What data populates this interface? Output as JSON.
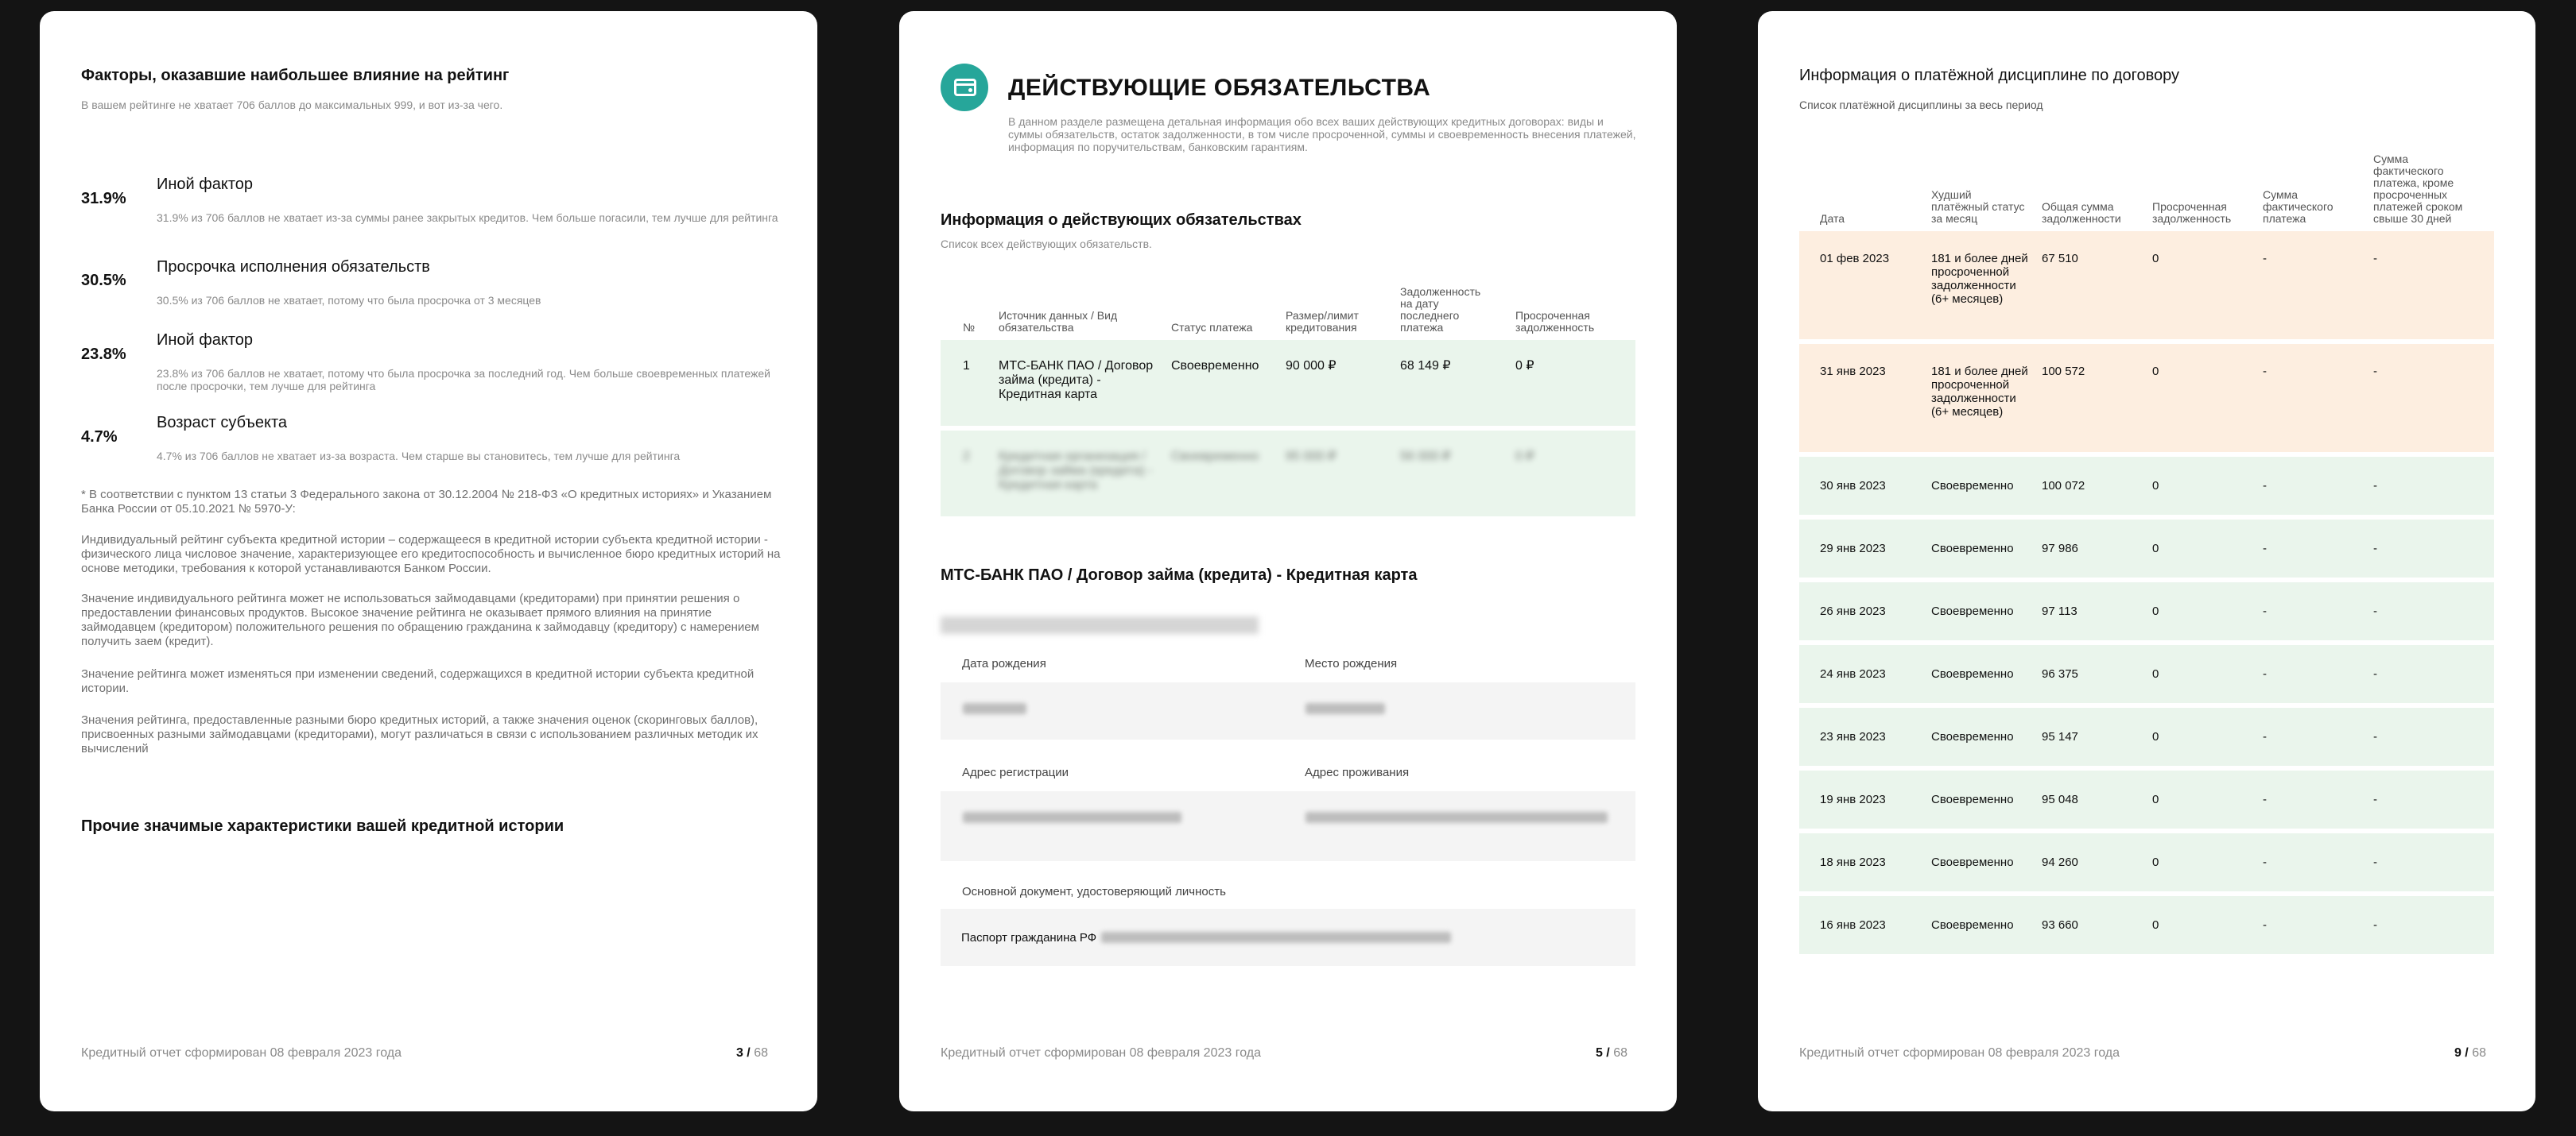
{
  "footer_text": "Кредитный отчет сформирован 08 февраля 2023 года",
  "total_pages": "68",
  "page1": {
    "page_number": "3 /",
    "title": "Факторы, оказавшие наибольшее влияние на рейтинг",
    "subtitle": "В вашем рейтинге не хватает 706  баллов до максимальных 999, и вот из-за чего.",
    "factors": [
      {
        "pct": "31.9%",
        "name": "Иной фактор",
        "desc": "31.9% из 706 баллов не хватает из-за суммы ранее закрытых кредитов. Чем больше погасили, тем лучше для рейтинга"
      },
      {
        "pct": "30.5%",
        "name": "Просрочка исполнения обязательств",
        "desc": "30.5% из 706 баллов не хватает, потому что была просрочка от 3 месяцев"
      },
      {
        "pct": "23.8%",
        "name": "Иной фактор",
        "desc": "23.8% из 706 баллов не хватает, потому что была просрочка за последний год. Чем больше своевременных платежей после просрочки, тем лучше для рейтинга"
      },
      {
        "pct": "4.7%",
        "name": "Возраст субъекта",
        "desc": "4.7% из 706 баллов не хватает из-за возраста. Чем старше вы становитесь, тем лучше для рейтинга"
      }
    ],
    "notes": [
      "* В соответствии с пунктом 13 статьи 3 Федерального закона от 30.12.2004 № 218-ФЗ «О кредитных историях» и Указанием Банка России от 05.10.2021 № 5970-У:",
      "Индивидуальный рейтинг субъекта кредитной истории – содержащееся в кредитной истории субъекта кредитной истории - физического лица числовое значение, характеризующее его кредитоспособность и вычисленное бюро кредитных историй на основе методики, требования к которой устанавливаются Банком России.",
      "Значение индивидуального рейтинга может не использоваться займодавцами (кредиторами) при принятии решения о предоставлении финансовых продуктов. Высокое значение рейтинга не оказывает прямого влияния на принятие займодавцем (кредитором) положительного решения по обращению гражданина к займодавцу (кредитору) с намерением получить заем (кредит).",
      "Значение рейтинга может изменяться при изменении сведений, содержащихся в кредитной истории субъекта кредитной истории.",
      "Значения рейтинга, предоставленные разными бюро кредитных историй, а также значения оценок (скоринговых баллов), присвоенных разными займодавцами (кредиторами), могут различаться в связи с использованием различных методик их вычислений"
    ],
    "section2_title": "Прочие значимые характеристики вашей кредитной истории"
  },
  "page2": {
    "page_number": "5 /",
    "title": "ДЕЙСТВУЮЩИЕ ОБЯЗАТЕЛЬСТВА",
    "intro": "В данном разделе размещена детальная информация обо всех ваших действующих кредитных договорах: виды и суммы обязательств, остаток задолженности, в том числе просроченной, суммы и своевременность внесения платежей, информация по поручительствам, банковским гарантиям.",
    "table_title": "Информация о действующих обязательствах",
    "table_subtitle": "Список всех действующих обязательств.",
    "headers": [
      "№",
      "Источник данных / Вид обязательства",
      "Статус платежа",
      "Размер/лимит кредитования",
      "Задолженность на дату последнего платежа",
      "Просроченная задолженность"
    ],
    "rows": [
      [
        "1",
        "МТС-БАНК ПАО / Договор займа (кредита) - Кредитная карта",
        "Своевременно",
        "90 000 ₽",
        "68 149 ₽",
        "0 ₽"
      ],
      [
        "2",
        "Кредитная организация / Договор займа (кредита) - Кредитная карта",
        "Своевременно",
        "95 000 ₽",
        "56 000 ₽",
        "0 ₽"
      ]
    ],
    "contract_title": "МТС-БАНК ПАО / Договор займа (кредита) - Кредитная карта",
    "labels": {
      "birth_date": "Дата рождения",
      "birth_place": "Место рождения",
      "reg_address": "Адрес регистрации",
      "res_address": "Адрес проживания",
      "id_doc": "Основной документ, удостоверяющий личность"
    },
    "passport_label": "Паспорт гражданина РФ"
  },
  "page3": {
    "page_number": "9 /",
    "title": "Информация о платёжной дисциплине по договору",
    "subtitle": "Список платёжной дисциплины за весь период",
    "headers": [
      "Дата",
      "Худший платёжный статус за месяц",
      "Общая сумма задолженности",
      "Просроченная задолженность",
      "Сумма фактического платежа",
      "Сумма фактического платежа, кроме просроченных платежей сроком свыше 30 дней"
    ],
    "rows": [
      {
        "date": "01 фев 2023",
        "status": "181 и более дней просроченной задолженности (6+ месяцев)",
        "total": "67 510",
        "overdue": "0",
        "paid": "-",
        "paid_ex": "-",
        "bad": true
      },
      {
        "date": "31 янв 2023",
        "status": "181 и более дней просроченной задолженности (6+ месяцев)",
        "total": "100 572",
        "overdue": "0",
        "paid": "-",
        "paid_ex": "-",
        "bad": true
      },
      {
        "date": "30 янв 2023",
        "status": "Своевременно",
        "total": "100 072",
        "overdue": "0",
        "paid": "-",
        "paid_ex": "-",
        "bad": false
      },
      {
        "date": "29 янв 2023",
        "status": "Своевременно",
        "total": "97 986",
        "overdue": "0",
        "paid": "-",
        "paid_ex": "-",
        "bad": false
      },
      {
        "date": "26 янв 2023",
        "status": "Своевременно",
        "total": "97 113",
        "overdue": "0",
        "paid": "-",
        "paid_ex": "-",
        "bad": false
      },
      {
        "date": "24 янв 2023",
        "status": "Своевременно",
        "total": "96 375",
        "overdue": "0",
        "paid": "-",
        "paid_ex": "-",
        "bad": false
      },
      {
        "date": "23 янв 2023",
        "status": "Своевременно",
        "total": "95 147",
        "overdue": "0",
        "paid": "-",
        "paid_ex": "-",
        "bad": false
      },
      {
        "date": "19 янв 2023",
        "status": "Своевременно",
        "total": "95 048",
        "overdue": "0",
        "paid": "-",
        "paid_ex": "-",
        "bad": false
      },
      {
        "date": "18 янв 2023",
        "status": "Своевременно",
        "total": "94 260",
        "overdue": "0",
        "paid": "-",
        "paid_ex": "-",
        "bad": false
      },
      {
        "date": "16 янв 2023",
        "status": "Своевременно",
        "total": "93 660",
        "overdue": "0",
        "paid": "-",
        "paid_ex": "-",
        "bad": false
      }
    ]
  }
}
